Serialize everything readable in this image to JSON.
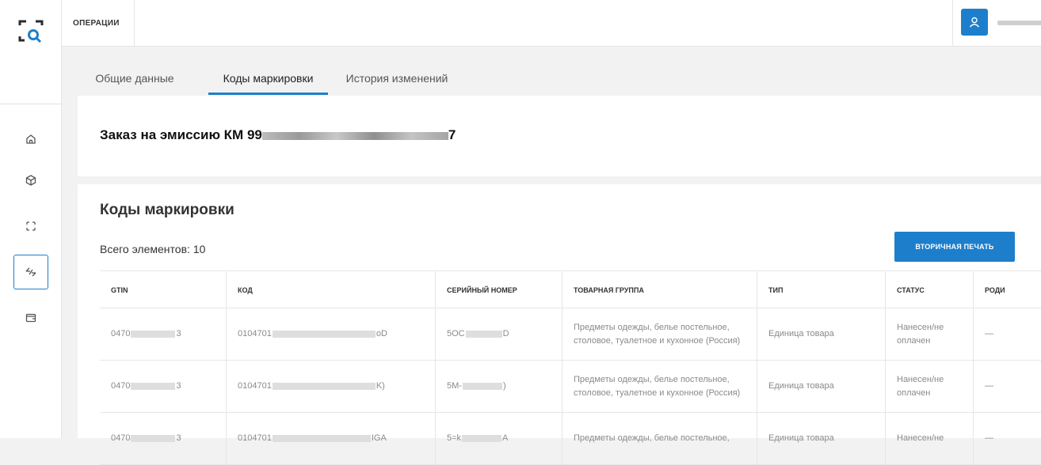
{
  "header": {
    "section_label": "ОПЕРАЦИИ"
  },
  "sidebar": {
    "items": [
      {
        "icon": "home-icon"
      },
      {
        "icon": "box-icon"
      },
      {
        "icon": "scan-frame-icon"
      },
      {
        "icon": "arrows-swap-icon",
        "active": true
      },
      {
        "icon": "wallet-icon"
      }
    ]
  },
  "tabs": [
    {
      "label": "Общие данные"
    },
    {
      "label": "Коды маркировки",
      "active": true
    },
    {
      "label": "История изменений"
    }
  ],
  "order": {
    "title_prefix": "Заказ на эмиссию КМ 99",
    "title_suffix": "7"
  },
  "codes": {
    "title": "Коды маркировки",
    "total": "Всего элементов: 10",
    "print_button": "ВТОРИЧНАЯ ПЕЧАТЬ",
    "columns": [
      "GTIN",
      "КОД",
      "СЕРИЙНЫЙ НОМЕР",
      "ТОВАРНАЯ ГРУППА",
      "ТИП",
      "СТАТУС",
      "РОДИ"
    ],
    "rows": [
      {
        "gtin_start": "0470",
        "gtin_end": "3",
        "code_start": "0104701",
        "code_end": "oD",
        "serial_start": "5OC",
        "serial_end": "D",
        "group": "Предметы одежды, белье постельное, столовое, туалетное и кухонное (Россия)",
        "type": "Единица товара",
        "status": "Нанесен/не оплачен",
        "parent": "—"
      },
      {
        "gtin_start": "0470",
        "gtin_end": "3",
        "code_start": "0104701",
        "code_end": "K)",
        "serial_start": "5M-",
        "serial_end": ")",
        "group": "Предметы одежды, белье постельное, столовое, туалетное и кухонное (Россия)",
        "type": "Единица товара",
        "status": "Нанесен/не оплачен",
        "parent": "—"
      },
      {
        "gtin_start": "0470",
        "gtin_end": "3",
        "code_start": "0104701",
        "code_end": "IGA",
        "serial_start": "5=k",
        "serial_end": "A",
        "group": "Предметы одежды, белье постельное,",
        "type": "Единица товара",
        "status": "Нанесен/не",
        "parent": "—"
      }
    ]
  },
  "colors": {
    "accent": "#1d7fcc",
    "background": "#f2f2f2"
  }
}
